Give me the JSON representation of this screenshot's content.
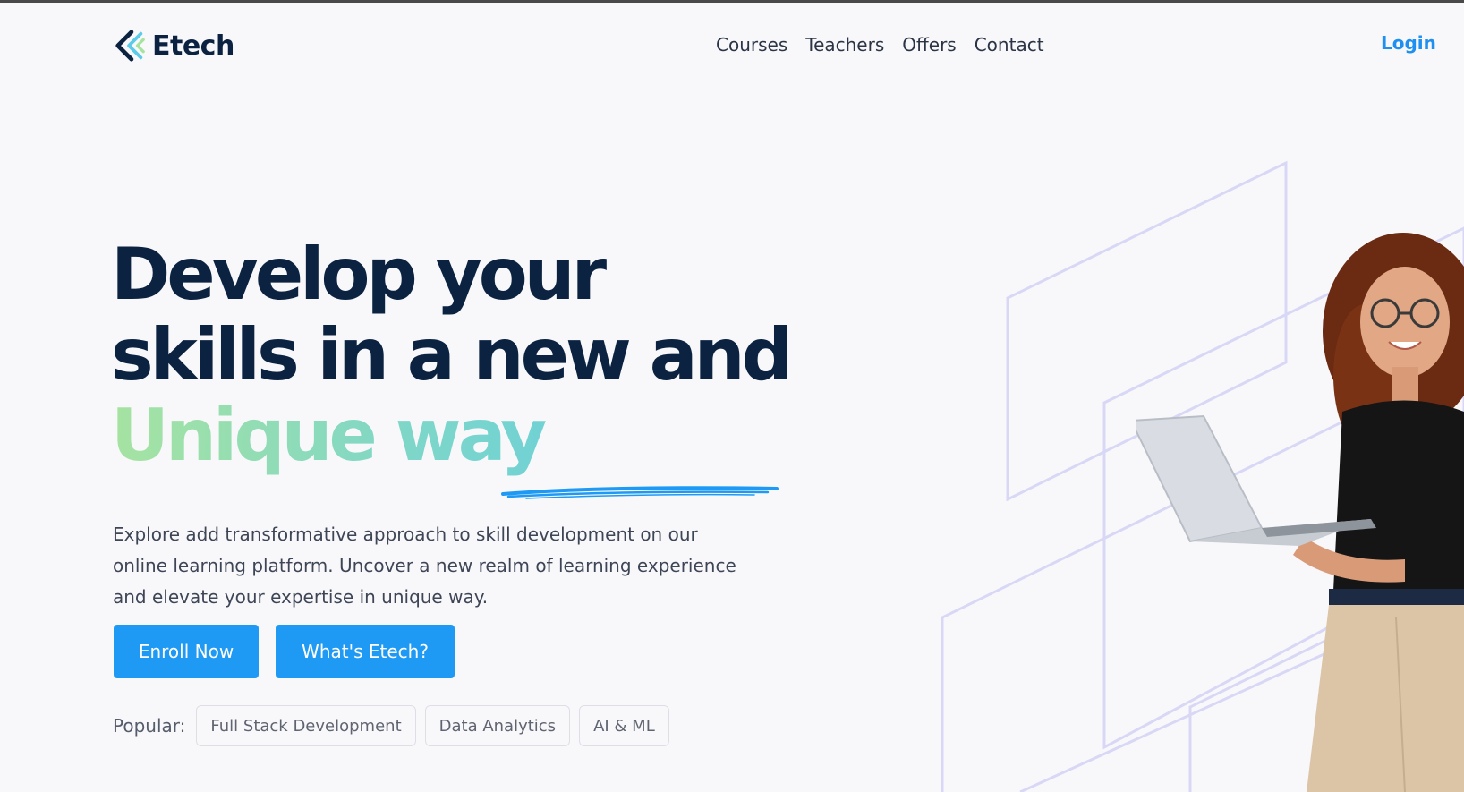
{
  "nav": {
    "brand": "Etech",
    "links": [
      "Courses",
      "Teachers",
      "Offers",
      "Contact"
    ],
    "login": "Login"
  },
  "hero": {
    "title_line1": "Develop your",
    "title_line2": "skills in a new and",
    "title_accent": "Unique way",
    "description": "Explore add transformative approach to skill development on our online learning platform. Uncover a new realm of learning experience and elevate your expertise in unique way.",
    "primary_button": "Enroll Now",
    "secondary_button": "What's Etech?"
  },
  "popular": {
    "label": "Popular:",
    "tags": [
      "Full Stack Development",
      "Data Analytics",
      "AI & ML"
    ]
  },
  "colors": {
    "navy": "#0b2340",
    "accent_blue": "#1e9af5",
    "gradient_green": "#a6e3a1",
    "gradient_cyan": "#5ccbe8",
    "background": "#f8f8fb",
    "line_lavender": "#d8d8f6"
  },
  "icons": {
    "logo": "etech-chevron-logo",
    "underline": "brush-underline"
  }
}
